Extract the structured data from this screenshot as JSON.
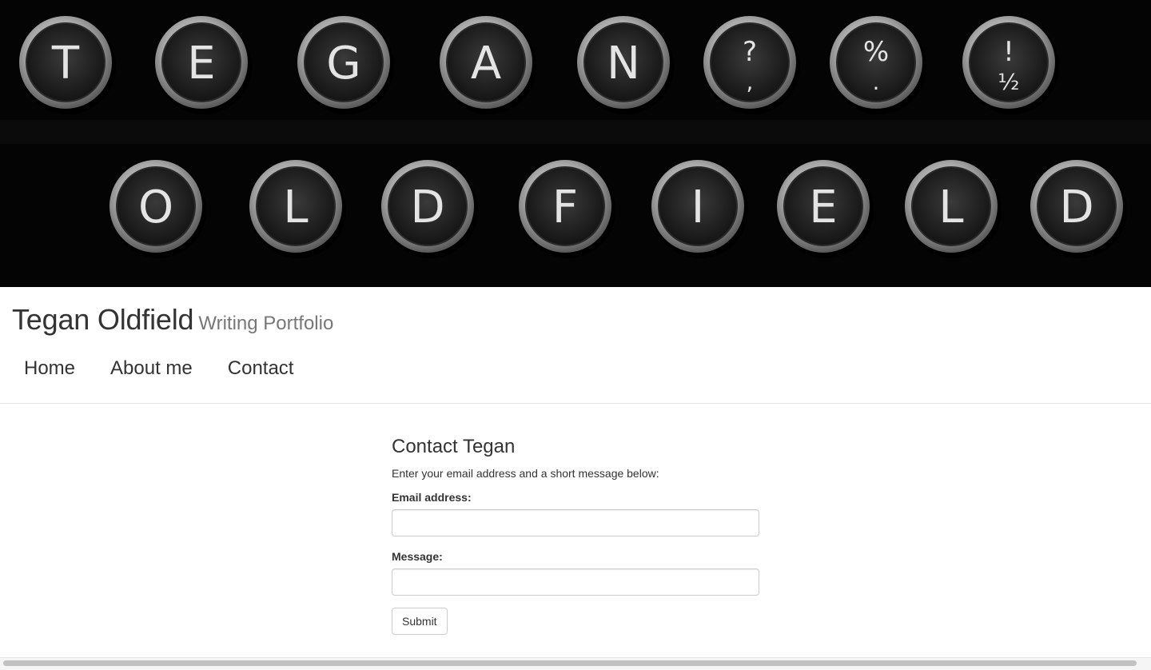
{
  "banner": {
    "row1_keys": [
      "T",
      "E",
      "G",
      "A",
      "N",
      "?",
      "%",
      "!"
    ],
    "row1_sub": [
      "",
      "",
      "",
      "",
      "",
      ",",
      ".",
      "½"
    ],
    "row2_keys": [
      "O",
      "L",
      "D",
      "F",
      "I",
      "E",
      "L",
      "D"
    ]
  },
  "header": {
    "brand_name": "Tegan Oldfield",
    "brand_tagline": "Writing Portfolio"
  },
  "nav": {
    "items": [
      {
        "label": "Home"
      },
      {
        "label": "About me"
      },
      {
        "label": "Contact"
      }
    ]
  },
  "contact": {
    "title": "Contact Tegan",
    "intro": "Enter your email address and a short message below:",
    "email_label": "Email address:",
    "email_value": "",
    "message_label": "Message:",
    "message_value": "",
    "submit_label": "Submit"
  },
  "colors": {
    "banner_bg": "#040404",
    "text": "#333333",
    "muted": "#777777"
  }
}
